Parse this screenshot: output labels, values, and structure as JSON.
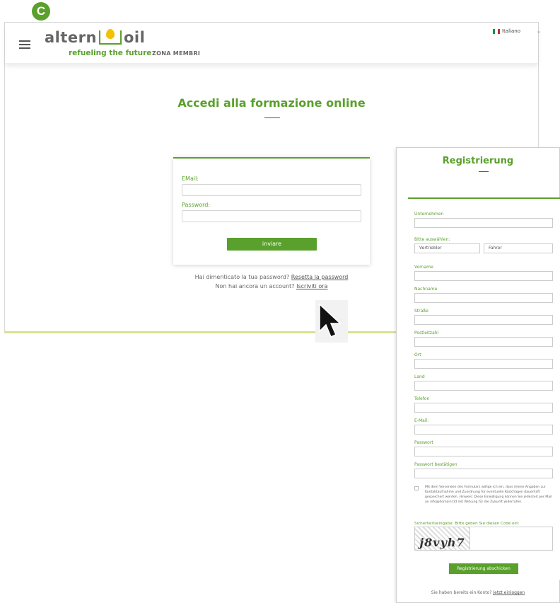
{
  "badge": {
    "letter": "C"
  },
  "header": {
    "logo_left": "altern",
    "logo_right": "oil",
    "tagline": "refueling the future",
    "section": "ZONA MEMBRI",
    "language": "Italiano",
    "flag_colors": [
      "#009246",
      "#ffffff",
      "#ce2b37"
    ]
  },
  "login": {
    "title": "Accedi alla formazione online",
    "email_label": "EMail:",
    "email_value": "",
    "password_label": "Password:",
    "password_value": "",
    "submit_label": "inviare",
    "forgot_text": "Hai dimenticato la tua password?",
    "forgot_link": "Resetta la password",
    "no_account_text": "Non hai ancora un account?",
    "signup_link": "Iscriviti ora"
  },
  "registration": {
    "title": "Registrierung",
    "company_label": "Unternehmen",
    "select_label": "Bitte auswählen:",
    "options": [
      "Vertriebler",
      "Fahrer"
    ],
    "fields": [
      "Vorname",
      "Nachname",
      "Straße",
      "Postleitzahl",
      "Ort",
      "Land",
      "Telefon",
      "E-Mail:",
      "Passwort",
      "Passwort bestätigen"
    ],
    "consent_text": "Mit dem Versenden des Formulars willige ich ein, dass meine Angaben zur Kontaktaufnahme und Zuordnung für eventuelle Rückfragen dauerhaft gespeichert werden. Hinweis: Diese Einwilligung können Sie jederzeit per Mail an info@domain.tld mit Wirkung für die Zukunft widerrufen.",
    "captcha_label": "Sicherheitseingabe: Bitte geben Sie diesen Code ein:",
    "captcha_code": "j8vyh7",
    "submit_label": "Registrierung abschicken",
    "footer_text": "Sie haben bereits ein Konto?",
    "footer_link": "Jetzt einloggen"
  },
  "colors": {
    "accent": "#5aa02c",
    "logo_drop": "#f2c200"
  }
}
